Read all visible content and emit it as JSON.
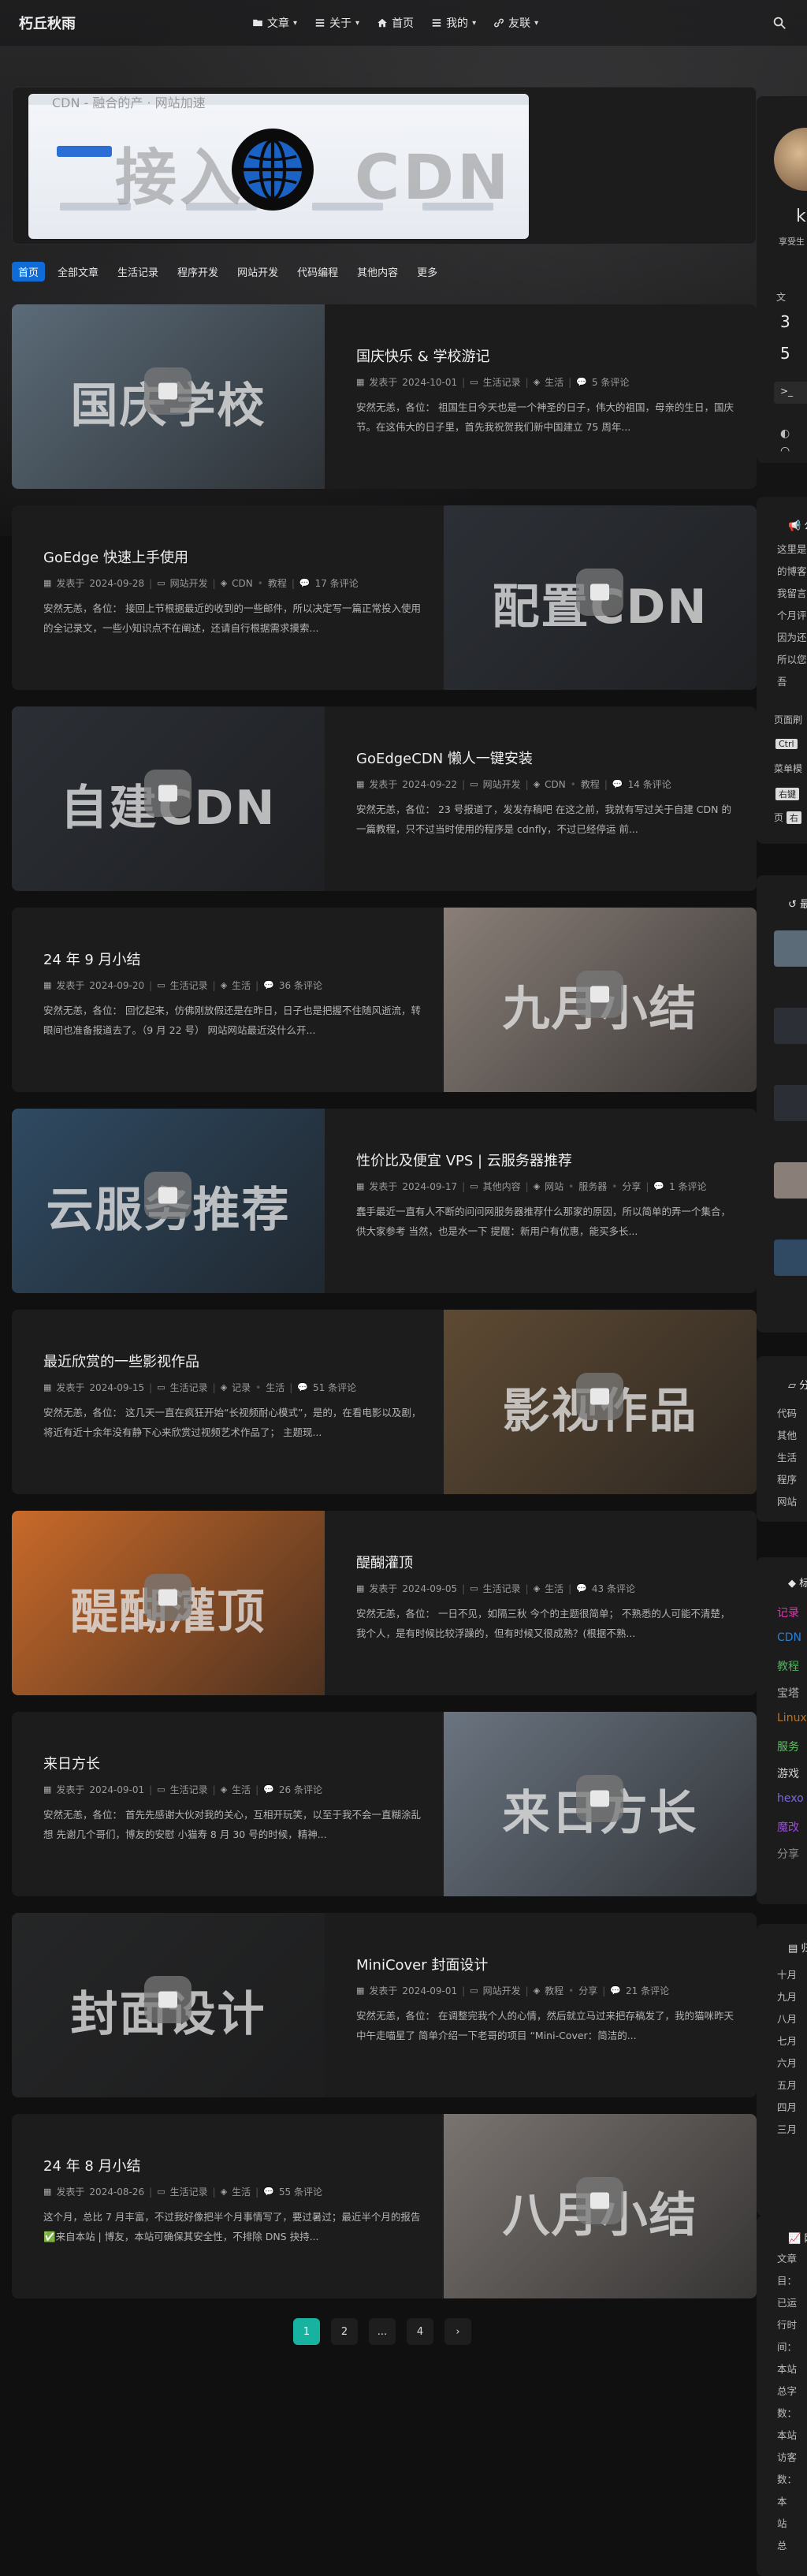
{
  "site": {
    "logo": "朽丘秋雨"
  },
  "nav": [
    {
      "label": "文章",
      "icon": "folder-icon",
      "dropdown": true
    },
    {
      "label": "关于",
      "icon": "list-icon",
      "dropdown": true
    },
    {
      "label": "首页",
      "icon": "home-icon",
      "dropdown": false
    },
    {
      "label": "我的",
      "icon": "list-icon",
      "dropdown": true
    },
    {
      "label": "友联",
      "icon": "link-icon",
      "dropdown": true
    }
  ],
  "banner": {
    "title_left": "接入",
    "title_right": "CDN",
    "header_text": "CDN - 融合的产 · 网站加速"
  },
  "tabs": [
    "首页",
    "全部文章",
    "生活记录",
    "程序开发",
    "网站开发",
    "代码编程",
    "其他内容",
    "更多"
  ],
  "meta_prefix": "发表于",
  "posts": [
    {
      "title": "国庆快乐 & 学校游记",
      "date": "2024-10-01",
      "category": "生活记录",
      "tags": [
        "生活"
      ],
      "comments": "5 条评论",
      "excerpt": "安然无恙，各位： 祖国生日今天也是一个神圣的日子，伟大的祖国，母亲的生日，国庆节。在这伟大的日子里，首先我祝贺我们新中国建立 75 周年...",
      "thumb_text": "国庆学校",
      "thumb_side": "left",
      "thumb_color": "#5b6b78"
    },
    {
      "title": "GoEdge 快速上手使用",
      "date": "2024-09-28",
      "category": "网站开发",
      "tags": [
        "CDN",
        "教程"
      ],
      "comments": "17 条评论",
      "excerpt": "安然无恙，各位： 接回上节根据最近的收到的一些邮件，所以决定写一篇正常投入使用的全记录文，一些小知识点不在阐述，还请自行根据需求摸索...",
      "thumb_text": "配置CDN",
      "thumb_side": "right",
      "thumb_color": "#2c3036"
    },
    {
      "title": "GoEdgeCDN 懒人一键安装",
      "date": "2024-09-22",
      "category": "网站开发",
      "tags": [
        "CDN",
        "教程"
      ],
      "comments": "14 条评论",
      "excerpt": "安然无恙，各位： 23 号报道了，发发存稿吧 在这之前，我就有写过关于自建 CDN 的一篇教程，只不过当时使用的程序是 cdnfly，不过已经停运 前...",
      "thumb_text": "自建CDN",
      "thumb_side": "left",
      "thumb_color": "#2b2f35"
    },
    {
      "title": "24 年 9 月小结",
      "date": "2024-09-20",
      "category": "生活记录",
      "tags": [
        "生活"
      ],
      "comments": "36 条评论",
      "excerpt": "安然无恙，各位： 回忆起来，仿佛刚放假还是在昨日，日子也是把握不住随风逝流，转眼间也准备报道去了。（9 月 22 号） 网站网站最近没什么开...",
      "thumb_text": "九月小结",
      "thumb_side": "right",
      "thumb_color": "#8a7f78"
    },
    {
      "title": "性价比及便宜 VPS | 云服务器推荐",
      "date": "2024-09-17",
      "category": "其他内容",
      "tags": [
        "网站",
        "服务器",
        "分享"
      ],
      "comments": "1 条评论",
      "excerpt": "蠢手最近一直有人不断的问问网服务器推荐什么那家的原因，所以简单的弄一个集合，供大家参考 当然，也是水一下 提醒：新用户有优惠，能买多长...",
      "thumb_text": "云服务推荐",
      "thumb_side": "left",
      "thumb_color": "#2f4a62"
    },
    {
      "title": "最近欣赏的一些影视作品",
      "date": "2024-09-15",
      "category": "生活记录",
      "tags": [
        "记录",
        "生活"
      ],
      "comments": "51 条评论",
      "excerpt": "安然无恙，各位： 这几天一直在疯狂开始“长视频耐心模式”，是的，在看电影以及剧，将近有近十余年没有静下心来欣赏过视频艺术作品了； 主题现...",
      "thumb_text": "影视作品",
      "thumb_side": "right",
      "thumb_color": "#5e4a33"
    },
    {
      "title": "醍醐灌顶",
      "date": "2024-09-05",
      "category": "生活记录",
      "tags": [
        "生活"
      ],
      "comments": "43 条评论",
      "excerpt": "安然无恙，各位： 一日不见，如隔三秋 今个的主题很简单； 不熟悉的人可能不清楚，我个人，是有时候比较浮躁的，但有时候又很成熟？(根据不熟...",
      "thumb_text": "醍醐灌顶",
      "thumb_side": "left",
      "thumb_color": "#c96a2a"
    },
    {
      "title": "来日方长",
      "date": "2024-09-01",
      "category": "生活记录",
      "tags": [
        "生活"
      ],
      "comments": "26 条评论",
      "excerpt": "安然无恙，各位： 首先先感谢大伙对我的关心，互相开玩笑，以至于我不会一直糊涂乱想 先谢几个哥们，博友的安慰 小猫寿 8 月 30 号的时候，精神...",
      "thumb_text": "来日方长",
      "thumb_side": "right",
      "thumb_color": "#6a7480"
    },
    {
      "title": "MiniCover 封面设计",
      "date": "2024-09-01",
      "category": "网站开发",
      "tags": [
        "教程",
        "分享"
      ],
      "comments": "21 条评论",
      "excerpt": "安然无恙，各位： 在调整完我个人的心情，然后就立马过来把存稿发了，我的猫咪昨天中午走喵星了 简单介绍一下老哥的项目 “Mini-Cover：简洁的...",
      "thumb_text": "封面设计",
      "thumb_side": "left",
      "thumb_color": "#252627"
    },
    {
      "title": "24 年 8 月小结",
      "date": "2024-08-26",
      "category": "生活记录",
      "tags": [
        "生活"
      ],
      "comments": "55 条评论",
      "excerpt": "这个月，总比 7 月丰富，不过我好像把半个月事情写了，要过暑过；最近半个月的报告 ✅来自本站 | 博友，本站可确保其安全性，不排除 DNS 抉持...",
      "thumb_text": "八月小结",
      "thumb_side": "right",
      "thumb_color": "#7a7470"
    }
  ],
  "pager": [
    "1",
    "2",
    "...",
    "4",
    "›"
  ],
  "sidebar": {
    "author_initial": "k",
    "author_sub": "享受生",
    "stats_label": "文",
    "stat_a": "3",
    "stat_b": "5",
    "announce_title": "公",
    "announce_lines": [
      "这里是",
      "的博客",
      "我留言",
      "个月评",
      "因为还",
      "所以您",
      "吾"
    ],
    "shortcut_label": "页面刷",
    "shortcut_key": "Ctrl",
    "contextmenu_label": "菜单模",
    "rightclick_key": "右键",
    "page_label": "页",
    "page_key": "右",
    "recent_title": "最",
    "category_title": "分",
    "categories": [
      "代码",
      "其他",
      "生活",
      "程序",
      "网站"
    ],
    "tag_title": "标",
    "tags": [
      {
        "text": "记录",
        "color": "#d43aa8"
      },
      {
        "text": "CDN",
        "color": "#2a7fd4"
      },
      {
        "text": "教程",
        "color": "#4fb35a"
      },
      {
        "text": "宝塔",
        "color": "#b0b0b0"
      },
      {
        "text": "Linux",
        "color": "#b8742a"
      },
      {
        "text": "服务",
        "color": "#5cc45c"
      },
      {
        "text": "游戏",
        "color": "#cfcfcf"
      },
      {
        "text": "hexo",
        "color": "#7a6ad8"
      },
      {
        "text": "魔改",
        "color": "#9a4ad8"
      },
      {
        "text": "分享",
        "color": "#8a8a8a"
      }
    ],
    "archive_title": "归",
    "archives": [
      "十月",
      "九月",
      "八月",
      "七月",
      "六月",
      "五月",
      "四月",
      "三月"
    ],
    "info_title": "网",
    "info_lines": [
      "文章",
      "目：",
      "已运",
      "行时",
      "间：",
      "本站",
      "总字",
      "数：",
      "本站",
      "访客",
      "数：",
      "本",
      "站",
      "总"
    ]
  }
}
